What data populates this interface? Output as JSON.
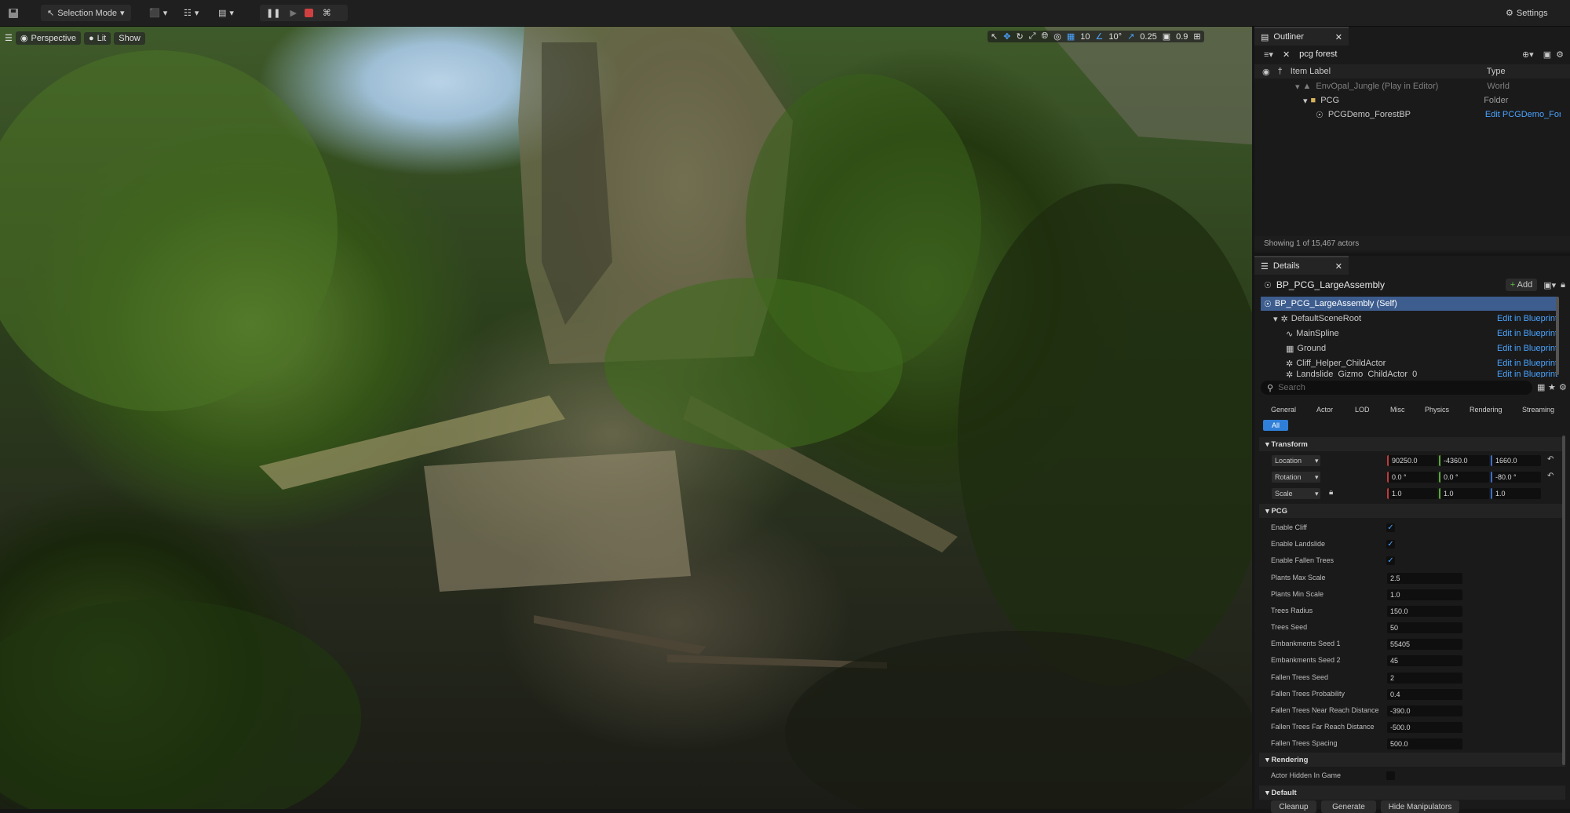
{
  "toolbar": {
    "mode_label": "Selection Mode",
    "settings_label": "Settings"
  },
  "viewport": {
    "view_mode": "Perspective",
    "lit_label": "Lit",
    "show_label": "Show",
    "grid_snap": "10",
    "rotation_snap": "10°",
    "scale_snap": "0.25",
    "camera_speed": "0.9"
  },
  "outliner": {
    "tab_title": "Outliner",
    "search_value": "pcg forest",
    "col_label": "Item Label",
    "col_type": "Type",
    "rows": [
      {
        "label": "EnvOpal_Jungle (Play in Editor)",
        "type": "World"
      },
      {
        "label": "PCG",
        "type": "Folder"
      },
      {
        "label": "PCGDemo_ForestBP",
        "type": "Edit PCGDemo_Forest"
      }
    ],
    "status": "Showing 1 of 15,467 actors"
  },
  "details": {
    "tab_title": "Details",
    "actor_name": "BP_PCG_LargeAssembly",
    "add_label": "Add",
    "components": [
      {
        "label": "BP_PCG_LargeAssembly (Self)",
        "action": ""
      },
      {
        "label": "DefaultSceneRoot",
        "action": "Edit in Blueprint"
      },
      {
        "label": "MainSpline",
        "action": "Edit in Blueprint"
      },
      {
        "label": "Ground",
        "action": "Edit in Blueprint"
      },
      {
        "label": "Cliff_Helper_ChildActor",
        "action": "Edit in Blueprint"
      },
      {
        "label": "Landslide_Gizmo_ChildActor_0",
        "action": "Edit in Blueprint"
      }
    ],
    "search_placeholder": "Search",
    "categories": [
      "General",
      "Actor",
      "LOD",
      "Misc",
      "Physics",
      "Rendering",
      "Streaming"
    ],
    "all_label": "All",
    "transform": {
      "header": "Transform",
      "location_label": "Location",
      "location": [
        "90250.0",
        "-4360.0",
        "1660.0"
      ],
      "rotation_label": "Rotation",
      "rotation": [
        "0.0 °",
        "0.0 °",
        "-80.0 °"
      ],
      "scale_label": "Scale",
      "scale": [
        "1.0",
        "1.0",
        "1.0"
      ]
    },
    "pcg": {
      "header": "PCG",
      "checks": [
        {
          "label": "Enable Cliff",
          "checked": true
        },
        {
          "label": "Enable Landslide",
          "checked": true
        },
        {
          "label": "Enable Fallen Trees",
          "checked": true
        }
      ],
      "fields": [
        {
          "label": "Plants Max Scale",
          "value": "2.5"
        },
        {
          "label": "Plants Min Scale",
          "value": "1.0"
        },
        {
          "label": "Trees Radius",
          "value": "150.0"
        },
        {
          "label": "Trees Seed",
          "value": "50"
        },
        {
          "label": "Embankments Seed 1",
          "value": "55405"
        },
        {
          "label": "Embankments Seed 2",
          "value": "45"
        },
        {
          "label": "Fallen Trees Seed",
          "value": "2"
        },
        {
          "label": "Fallen Trees Probability",
          "value": "0.4"
        },
        {
          "label": "Fallen Trees Near Reach Distance",
          "value": "-390.0"
        },
        {
          "label": "Fallen Trees Far Reach Distance",
          "value": "-500.0"
        },
        {
          "label": "Fallen Trees Spacing",
          "value": "500.0"
        }
      ]
    },
    "rendering": {
      "header": "Rendering",
      "actor_hidden_label": "Actor Hidden In Game",
      "actor_hidden": false
    },
    "default_section": {
      "header": "Default",
      "buttons": [
        "Cleanup",
        "Generate",
        "Hide Manipulators"
      ]
    }
  },
  "colors": {
    "accent": "#4aa3ff",
    "selection": "#3d5d8f",
    "x_axis": "#c23b3b",
    "y_axis": "#5aa83c",
    "z_axis": "#3c6ec8",
    "stop": "#d04040"
  }
}
